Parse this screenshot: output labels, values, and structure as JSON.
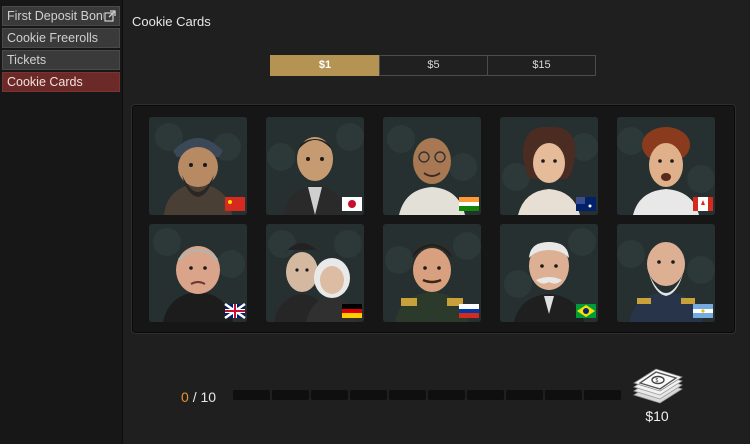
{
  "sidebar": {
    "items": [
      {
        "label": "First Deposit Bonus"
      },
      {
        "label": "Cookie Freerolls"
      },
      {
        "label": "Tickets"
      },
      {
        "label": "Cookie Cards"
      }
    ]
  },
  "main": {
    "title": "Cookie Cards",
    "tabs": [
      {
        "label": "$1",
        "active": true
      },
      {
        "label": "$5",
        "active": false
      },
      {
        "label": "$15",
        "active": false
      }
    ],
    "cards": [
      {
        "icon": "confucius-card-icon",
        "flag": "china"
      },
      {
        "icon": "japanese-figure-card-icon",
        "flag": "japan"
      },
      {
        "icon": "gandhi-card-icon",
        "flag": "india"
      },
      {
        "icon": "woman-card-icon",
        "flag": "australia"
      },
      {
        "icon": "curly-runner-card-icon",
        "flag": "canada"
      },
      {
        "icon": "churchill-card-icon",
        "flag": "uk"
      },
      {
        "icon": "brothers-card-icon",
        "flag": "germany"
      },
      {
        "icon": "russian-officer-card-icon",
        "flag": "russia"
      },
      {
        "icon": "brazilian-figure-card-icon",
        "flag": "brazil"
      },
      {
        "icon": "argentine-general-card-icon",
        "flag": "argentina"
      }
    ],
    "progress": {
      "current": "0",
      "separator": "/",
      "total": "10",
      "segments": 10
    },
    "reward": {
      "icon": "cash-stack-icon",
      "amount": "$10"
    }
  },
  "colors": {
    "active_tab": "#b59353",
    "active_sidebar": "#6b2a28",
    "progress_current": "#e8932d"
  }
}
